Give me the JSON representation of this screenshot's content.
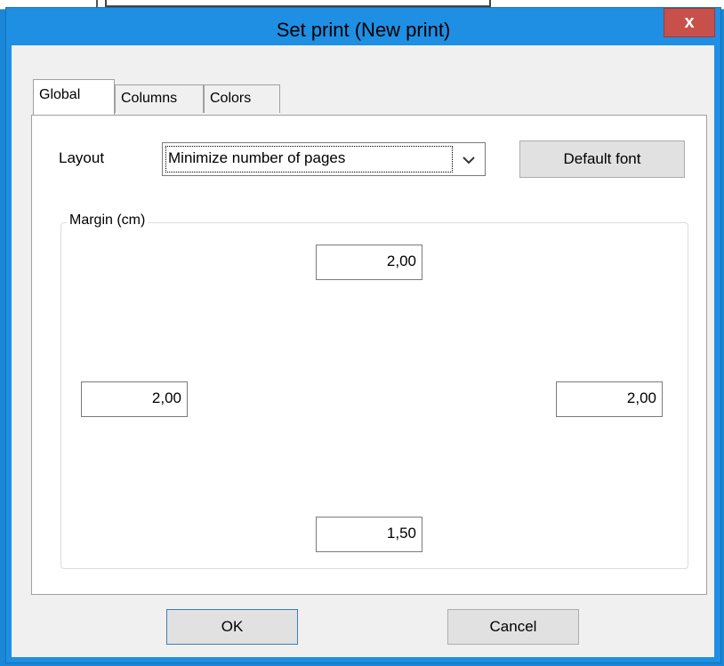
{
  "dialog": {
    "title": "Set print (New print)",
    "close_label": "x"
  },
  "tabs": [
    {
      "label": "Global",
      "active": true
    },
    {
      "label": "Columns",
      "active": false
    },
    {
      "label": "Colors",
      "active": false
    }
  ],
  "layout": {
    "label": "Layout",
    "selected": "Minimize number of pages"
  },
  "default_font_label": "Default font",
  "margin": {
    "title": "Margin (cm)",
    "top": "2,00",
    "left": "2,00",
    "right": "2,00",
    "bottom": "1,50"
  },
  "buttons": {
    "ok": "OK",
    "cancel": "Cancel"
  },
  "colors": {
    "title_bar": "#1f8fe3",
    "close_button": "#c7504a",
    "dialog_bg": "#f0f0f0"
  }
}
